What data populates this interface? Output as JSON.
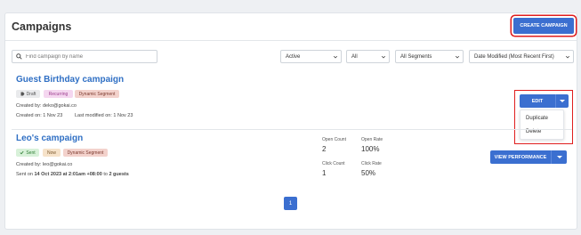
{
  "header": {
    "title": "Campaigns",
    "create_button": "CREATE CAMPAIGN"
  },
  "filters": {
    "search_placeholder": "Find campaign by name",
    "status": "Active",
    "type": "All",
    "segments": "All Segments",
    "sort": "Date Modified (Most Recent First)"
  },
  "campaigns": [
    {
      "title": "Guest Birthday campaign",
      "tags": [
        "Draft",
        "Recurring",
        "Dynamic Segment"
      ],
      "created_by": "Created by: deko@gokai.co",
      "created_on": "Created on: 1 Nov 23",
      "last_modified": "Last modified on: 1 Nov 23",
      "edit_button": "EDIT",
      "menu": [
        "Duplicate",
        "Delete"
      ]
    },
    {
      "title": "Leo's campaign",
      "tags": [
        "Sent",
        "Now",
        "Dynamic Segment"
      ],
      "created_by": "Created by: leo@gokai.co",
      "sent_prefix": "Sent on ",
      "sent_date": "14 Oct 2023 at 2:01am +08:00",
      "sent_mid": " to ",
      "sent_guests": "2 guests",
      "stats": {
        "open_count_label": "Open Count",
        "open_count": "2",
        "open_rate_label": "Open Rate",
        "open_rate": "100%",
        "click_count_label": "Click Count",
        "click_count": "1",
        "click_rate_label": "Click Rate",
        "click_rate": "50%"
      },
      "perf_button": "VIEW PERFORMANCE"
    }
  ],
  "pagination": {
    "current": "1"
  },
  "colors": {
    "primary": "#3b6fd0",
    "link": "#2f6fc4",
    "highlight": "#e01e1e"
  },
  "icons": [
    "search-icon",
    "chevron-down-icon",
    "check-icon",
    "tag-icon",
    "caret-down-icon"
  ]
}
